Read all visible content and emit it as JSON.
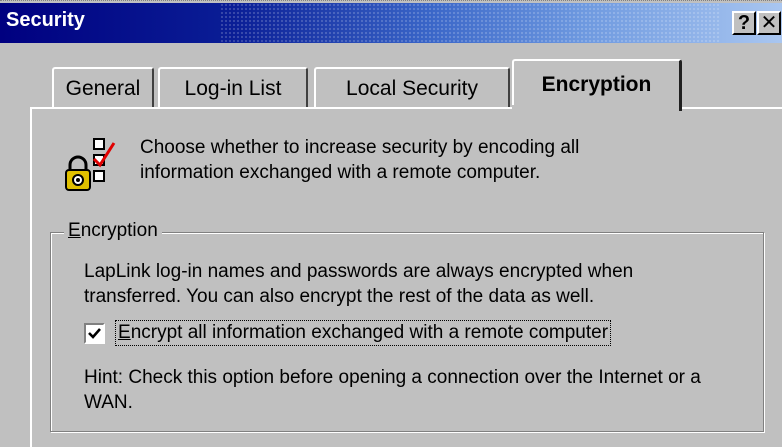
{
  "window": {
    "title": "Security",
    "help_label": "?",
    "close_label": "✕"
  },
  "tabs": [
    {
      "label": "General",
      "selected": false
    },
    {
      "label": "Log-in List",
      "selected": false
    },
    {
      "label": "Local Security",
      "selected": false
    },
    {
      "label": "Encryption",
      "selected": true
    }
  ],
  "intro": {
    "icon": "lock-checklist-icon",
    "text": "Choose whether to increase security by encoding all information exchanged with a remote computer."
  },
  "encryption_group": {
    "label_mnemonic": "E",
    "label_rest": "ncryption",
    "description": "LapLink log-in names and passwords are always encrypted when transferred.  You can also encrypt the rest of the data as well.",
    "checkbox": {
      "checked": true,
      "label_mnemonic": "E",
      "label_rest": "ncrypt all information exchanged with a remote computer"
    },
    "hint": "Hint: Check this option before opening a connection over the Internet or a WAN."
  }
}
